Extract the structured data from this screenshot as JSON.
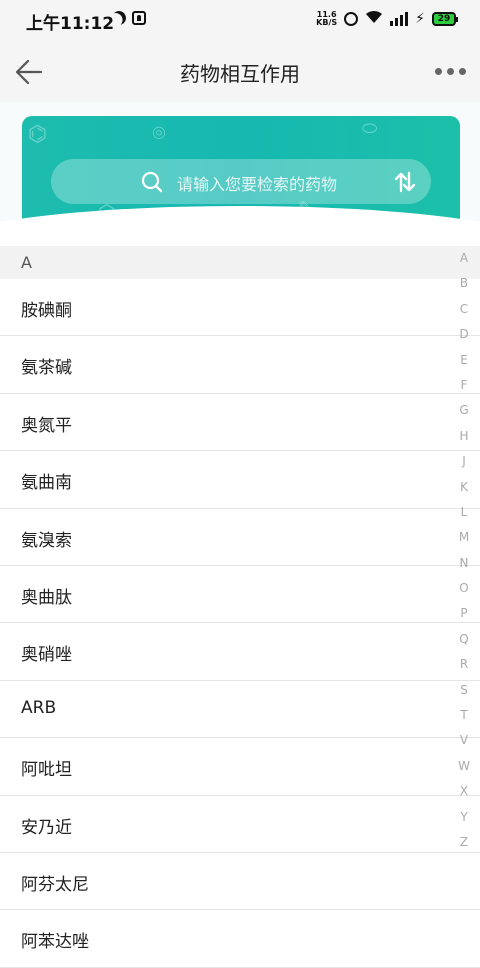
{
  "status_bar": {
    "time": "上午11:12",
    "net_speed_value": "11.6",
    "net_speed_unit": "KB/S",
    "network_type": "4G",
    "battery_level": "29",
    "battery_color": "#2ecc40"
  },
  "header": {
    "title": "药物相互作用",
    "back_icon": "back-arrow-icon",
    "more_icon": "more-dots-icon"
  },
  "search": {
    "placeholder": "请输入您要检索的药物",
    "icon": "search-icon",
    "swap_icon": "swap-icon"
  },
  "banner_colors": {
    "start": "#1ebcaf",
    "end": "#1cc0a9"
  },
  "section": {
    "letter": "A"
  },
  "drugs": [
    "胺碘酮",
    "氨茶碱",
    "奥氮平",
    "氨曲南",
    "氨溴索",
    "奥曲肽",
    "奥硝唑",
    "ARB",
    "阿吡坦",
    "安乃近",
    "阿芬太尼",
    "阿苯达唑"
  ],
  "alphabet_index": [
    "A",
    "B",
    "C",
    "D",
    "E",
    "F",
    "G",
    "H",
    "J",
    "K",
    "L",
    "M",
    "N",
    "O",
    "P",
    "Q",
    "R",
    "S",
    "T",
    "V",
    "W",
    "X",
    "Y",
    "Z"
  ]
}
